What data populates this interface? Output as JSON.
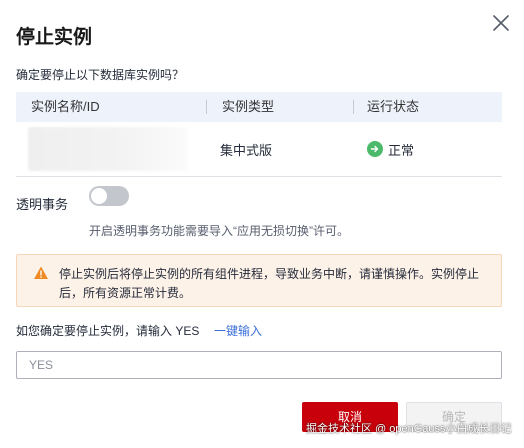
{
  "dialog": {
    "title": "停止实例",
    "confirm_text": "确定要停止以下数据库实例吗？"
  },
  "table": {
    "columns": [
      "实例名称/ID",
      "实例类型",
      "运行状态"
    ],
    "rows": [
      {
        "type": "集中式版",
        "status": "正常"
      }
    ]
  },
  "transaction": {
    "label": "透明事务",
    "enabled": false,
    "hint": "开启透明事务功能需要导入“应用无损切换”许可。"
  },
  "alert": {
    "text": "停止实例后将停止实例的所有组件进程，导致业务中断，请谨慎操作。实例停止后，所有资源正常计费。"
  },
  "confirm_input": {
    "prompt": "如您确定要停止实例，请输入 YES",
    "quick_input_label": "一键输入",
    "placeholder": "YES",
    "value": ""
  },
  "buttons": {
    "cancel": "取消",
    "ok": "确定"
  },
  "watermark": "掘金技术社区 @ openGauss小白成长日记",
  "colors": {
    "primary_red": "#c7000b",
    "link_blue": "#3a6fd8",
    "status_green": "#4cb96b",
    "warning_orange": "#f08a24"
  }
}
